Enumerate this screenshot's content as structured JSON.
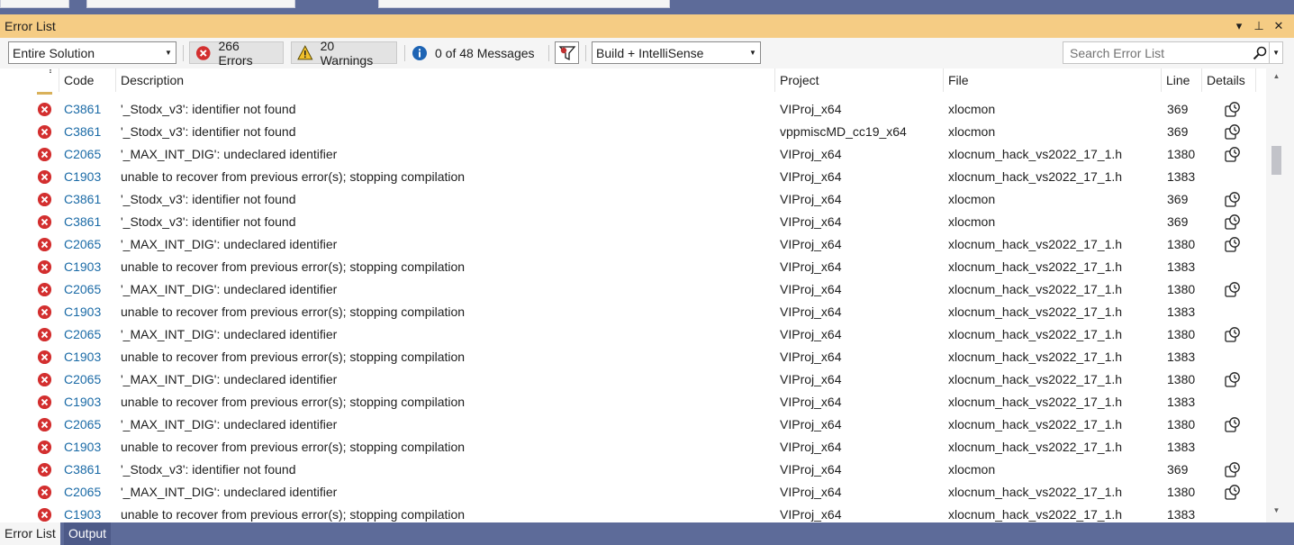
{
  "window": {
    "title": "Error List",
    "controls": {
      "dropdown": "▾",
      "pin": "⊥",
      "close": "✕"
    }
  },
  "toolbar": {
    "scope": "Entire Solution",
    "errors_label": "266 Errors",
    "warnings_label": "20 Warnings",
    "messages_label": "0 of 48 Messages",
    "build_filter": "Build + IntelliSense",
    "search_placeholder": "Search Error List"
  },
  "columns": {
    "code": "Code",
    "description": "Description",
    "project": "Project",
    "file": "File",
    "line": "Line",
    "details": "Details"
  },
  "rows": [
    {
      "code": "C3861",
      "description": "'_Stodx_v3': identifier not found",
      "project": "VIProj_x64",
      "file": "xlocmon",
      "line": "369",
      "details": true
    },
    {
      "code": "C3861",
      "description": "'_Stodx_v3': identifier not found",
      "project": "vppmiscMD_cc19_x64",
      "file": "xlocmon",
      "line": "369",
      "details": true
    },
    {
      "code": "C2065",
      "description": "'_MAX_INT_DIG': undeclared identifier",
      "project": "VIProj_x64",
      "file": "xlocnum_hack_vs2022_17_1.h",
      "line": "1380",
      "details": true
    },
    {
      "code": "C1903",
      "description": "unable to recover from previous error(s); stopping compilation",
      "project": "VIProj_x64",
      "file": "xlocnum_hack_vs2022_17_1.h",
      "line": "1383",
      "details": false
    },
    {
      "code": "C3861",
      "description": "'_Stodx_v3': identifier not found",
      "project": "VIProj_x64",
      "file": "xlocmon",
      "line": "369",
      "details": true
    },
    {
      "code": "C3861",
      "description": "'_Stodx_v3': identifier not found",
      "project": "VIProj_x64",
      "file": "xlocmon",
      "line": "369",
      "details": true
    },
    {
      "code": "C2065",
      "description": "'_MAX_INT_DIG': undeclared identifier",
      "project": "VIProj_x64",
      "file": "xlocnum_hack_vs2022_17_1.h",
      "line": "1380",
      "details": true
    },
    {
      "code": "C1903",
      "description": "unable to recover from previous error(s); stopping compilation",
      "project": "VIProj_x64",
      "file": "xlocnum_hack_vs2022_17_1.h",
      "line": "1383",
      "details": false
    },
    {
      "code": "C2065",
      "description": "'_MAX_INT_DIG': undeclared identifier",
      "project": "VIProj_x64",
      "file": "xlocnum_hack_vs2022_17_1.h",
      "line": "1380",
      "details": true
    },
    {
      "code": "C1903",
      "description": "unable to recover from previous error(s); stopping compilation",
      "project": "VIProj_x64",
      "file": "xlocnum_hack_vs2022_17_1.h",
      "line": "1383",
      "details": false
    },
    {
      "code": "C2065",
      "description": "'_MAX_INT_DIG': undeclared identifier",
      "project": "VIProj_x64",
      "file": "xlocnum_hack_vs2022_17_1.h",
      "line": "1380",
      "details": true
    },
    {
      "code": "C1903",
      "description": "unable to recover from previous error(s); stopping compilation",
      "project": "VIProj_x64",
      "file": "xlocnum_hack_vs2022_17_1.h",
      "line": "1383",
      "details": false
    },
    {
      "code": "C2065",
      "description": "'_MAX_INT_DIG': undeclared identifier",
      "project": "VIProj_x64",
      "file": "xlocnum_hack_vs2022_17_1.h",
      "line": "1380",
      "details": true
    },
    {
      "code": "C1903",
      "description": "unable to recover from previous error(s); stopping compilation",
      "project": "VIProj_x64",
      "file": "xlocnum_hack_vs2022_17_1.h",
      "line": "1383",
      "details": false
    },
    {
      "code": "C2065",
      "description": "'_MAX_INT_DIG': undeclared identifier",
      "project": "VIProj_x64",
      "file": "xlocnum_hack_vs2022_17_1.h",
      "line": "1380",
      "details": true
    },
    {
      "code": "C1903",
      "description": "unable to recover from previous error(s); stopping compilation",
      "project": "VIProj_x64",
      "file": "xlocnum_hack_vs2022_17_1.h",
      "line": "1383",
      "details": false
    },
    {
      "code": "C3861",
      "description": "'_Stodx_v3': identifier not found",
      "project": "VIProj_x64",
      "file": "xlocmon",
      "line": "369",
      "details": true
    },
    {
      "code": "C2065",
      "description": "'_MAX_INT_DIG': undeclared identifier",
      "project": "VIProj_x64",
      "file": "xlocnum_hack_vs2022_17_1.h",
      "line": "1380",
      "details": true
    },
    {
      "code": "C1903",
      "description": "unable to recover from previous error(s); stopping compilation",
      "project": "VIProj_x64",
      "file": "xlocnum_hack_vs2022_17_1.h",
      "line": "1383",
      "details": false
    }
  ],
  "bottom_tabs": [
    {
      "label": "Error List",
      "active": true
    },
    {
      "label": "Output",
      "active": false
    }
  ],
  "icons": {
    "error": "error-icon",
    "warning": "warning-icon",
    "info": "info-icon",
    "filter": "filter-icon",
    "details": "details-icon",
    "search": "search-icon"
  },
  "colors": {
    "title_bar": "#f5cc84",
    "frame": "#5d6b99",
    "error_red": "#d32f2f",
    "code_link": "#1a6aa6",
    "warning_yellow": "#f0c02c",
    "info_blue": "#1e64b4",
    "filter_red": "#c03030"
  }
}
